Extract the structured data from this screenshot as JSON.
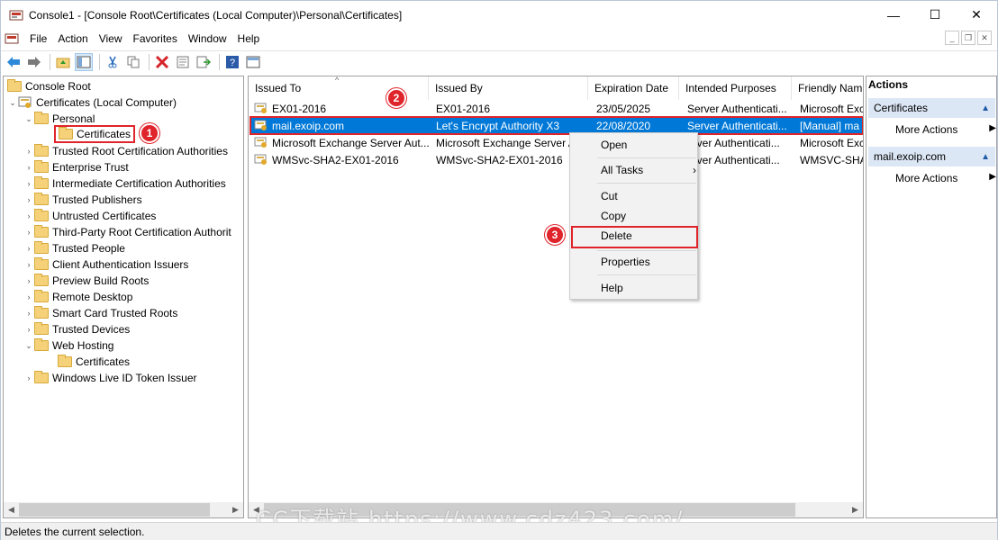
{
  "window": {
    "title": "Console1 - [Console Root\\Certificates (Local Computer)\\Personal\\Certificates]",
    "minimize": "—",
    "maximize": "☐",
    "close": "✕"
  },
  "menu": [
    "File",
    "Action",
    "View",
    "Favorites",
    "Window",
    "Help"
  ],
  "tree": {
    "root": "Console Root",
    "computer": "Certificates (Local Computer)",
    "personal": "Personal",
    "certificates": "Certificates",
    "stores": [
      "Trusted Root Certification Authorities",
      "Enterprise Trust",
      "Intermediate Certification Authorities",
      "Trusted Publishers",
      "Untrusted Certificates",
      "Third-Party Root Certification Authorit",
      "Trusted People",
      "Client Authentication Issuers",
      "Preview Build Roots",
      "Remote Desktop",
      "Smart Card Trusted Roots",
      "Trusted Devices"
    ],
    "web_hosting": "Web Hosting",
    "web_hosting_child": "Certificates",
    "live_id": "Windows Live ID Token Issuer"
  },
  "list": {
    "columns": [
      "Issued To",
      "Issued By",
      "Expiration Date",
      "Intended Purposes",
      "Friendly Nam"
    ],
    "rows": [
      [
        "EX01-2016",
        "EX01-2016",
        "23/05/2025",
        "Server Authenticati...",
        "Microsoft Exc"
      ],
      [
        "mail.exoip.com",
        "Let's Encrypt Authority X3",
        "22/08/2020",
        "Server Authenticati...",
        "[Manual] ma"
      ],
      [
        "Microsoft Exchange Server Aut...",
        "Microsoft Exchange Server A",
        "",
        "erver Authenticati...",
        "Microsoft Exc"
      ],
      [
        "WMSvc-SHA2-EX01-2016",
        "WMSvc-SHA2-EX01-2016",
        "",
        "erver Authenticati...",
        "WMSVC-SHA"
      ]
    ]
  },
  "context_menu": {
    "open": "Open",
    "all_tasks": "All Tasks",
    "cut": "Cut",
    "copy": "Copy",
    "delete": "Delete",
    "properties": "Properties",
    "help": "Help"
  },
  "actions": {
    "title": "Actions",
    "section1": "Certificates",
    "section1_item": "More Actions",
    "section2": "mail.exoip.com",
    "section2_item": "More Actions"
  },
  "status": "Deletes the current selection.",
  "badges": [
    "1",
    "2",
    "3"
  ],
  "watermark": "CC下载站 https://www.cdz423.com/",
  "colors": {
    "selection": "#0078d7",
    "highlight": "#e0242b",
    "actions_header": "#dce7f5"
  }
}
